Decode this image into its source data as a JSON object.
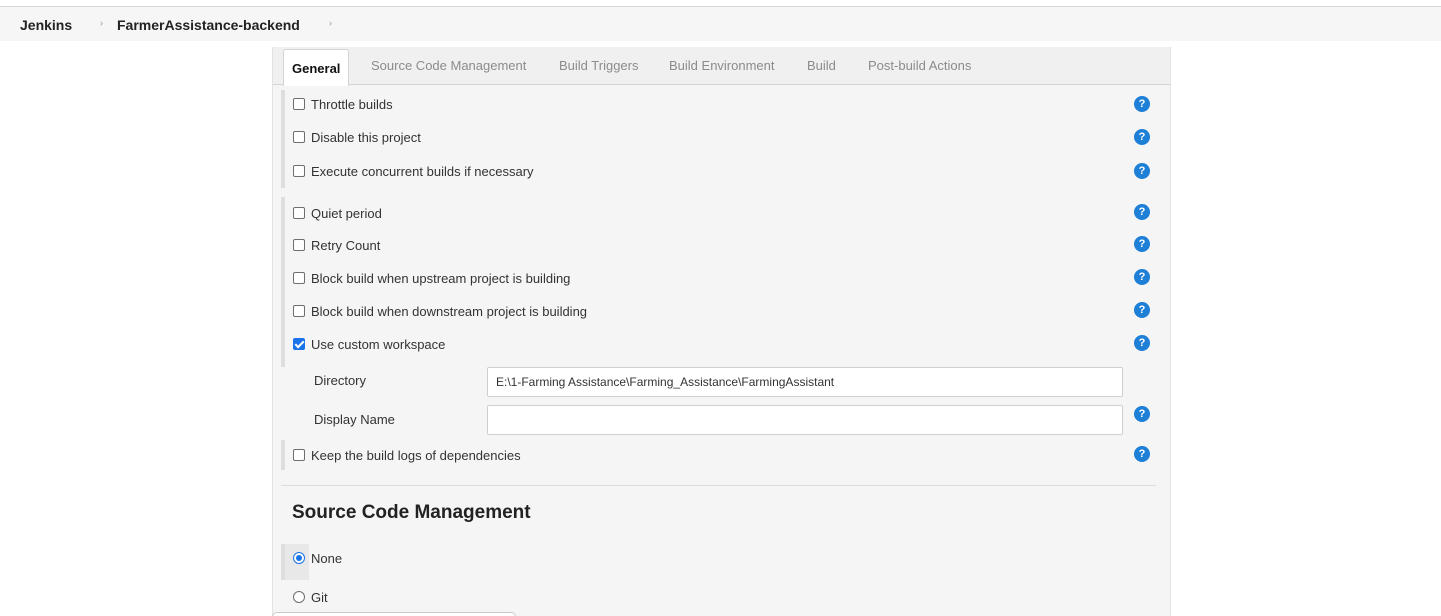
{
  "breadcrumb": {
    "root": "Jenkins",
    "project": "FarmerAssistance-backend",
    "separator": "›"
  },
  "tabs": [
    {
      "label": "General",
      "active": true
    },
    {
      "label": "Source Code Management",
      "active": false
    },
    {
      "label": "Build Triggers",
      "active": false
    },
    {
      "label": "Build Environment",
      "active": false
    },
    {
      "label": "Build",
      "active": false
    },
    {
      "label": "Post-build Actions",
      "active": false
    }
  ],
  "general": {
    "options": [
      {
        "label": "Throttle builds",
        "checked": false
      },
      {
        "label": "Disable this project",
        "checked": false
      },
      {
        "label": "Execute concurrent builds if necessary",
        "checked": false
      },
      {
        "label": "Quiet period",
        "checked": false
      },
      {
        "label": "Retry Count",
        "checked": false
      },
      {
        "label": "Block build when upstream project is building",
        "checked": false
      },
      {
        "label": "Block build when downstream project is building",
        "checked": false
      },
      {
        "label": "Use custom workspace",
        "checked": true
      },
      {
        "label": "Keep the build logs of dependencies",
        "checked": false
      }
    ],
    "workspace": {
      "directory_label": "Directory",
      "directory_value": "E:\\1-Farming Assistance\\Farming_Assistance\\FarmingAssistant",
      "display_name_label": "Display Name",
      "display_name_value": ""
    }
  },
  "scm": {
    "heading": "Source Code Management",
    "options": [
      {
        "label": "None",
        "selected": true
      },
      {
        "label": "Git",
        "selected": false
      }
    ]
  },
  "icons": {
    "help": "question-mark-icon",
    "help_glyph": "?"
  },
  "colors": {
    "accent": "#1a73e8",
    "help_icon": "#1e7fd6"
  }
}
